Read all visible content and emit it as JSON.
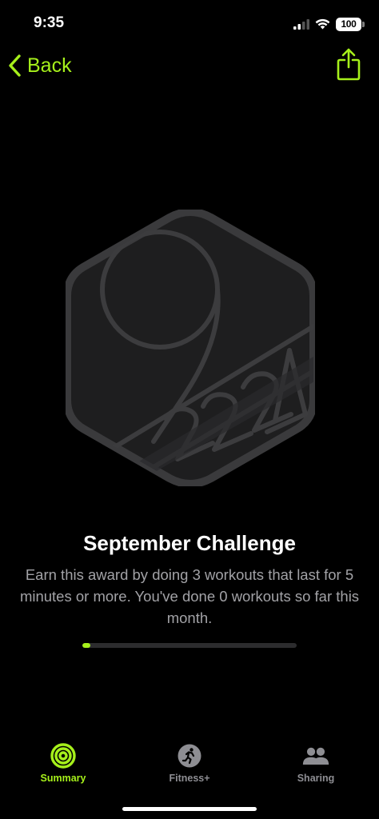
{
  "status_bar": {
    "time": "9:35",
    "battery": "100"
  },
  "nav": {
    "back_label": "Back",
    "icons": [
      "chevron-left-icon",
      "share-icon"
    ]
  },
  "badge": {
    "icon": "september-2024-challenge-badge",
    "month_numeral": "9",
    "year": "2024"
  },
  "award": {
    "title": "September Challenge",
    "description": "Earn this award by doing 3 workouts that last for 5 minutes or more. You've done 0 workouts so far this month.",
    "progress": 0
  },
  "tabs": [
    {
      "label": "Summary",
      "icon": "activity-rings-icon",
      "selected": true
    },
    {
      "label": "Fitness+",
      "icon": "fitness-plus-runner-icon",
      "selected": false
    },
    {
      "label": "Sharing",
      "icon": "sharing-people-icon",
      "selected": false
    }
  ],
  "colors": {
    "accent": "#a6f01b",
    "background": "#000000",
    "secondary_text": "#a2a2a6",
    "badge_fill": "#222223",
    "badge_stroke": "#3a3a3c"
  }
}
